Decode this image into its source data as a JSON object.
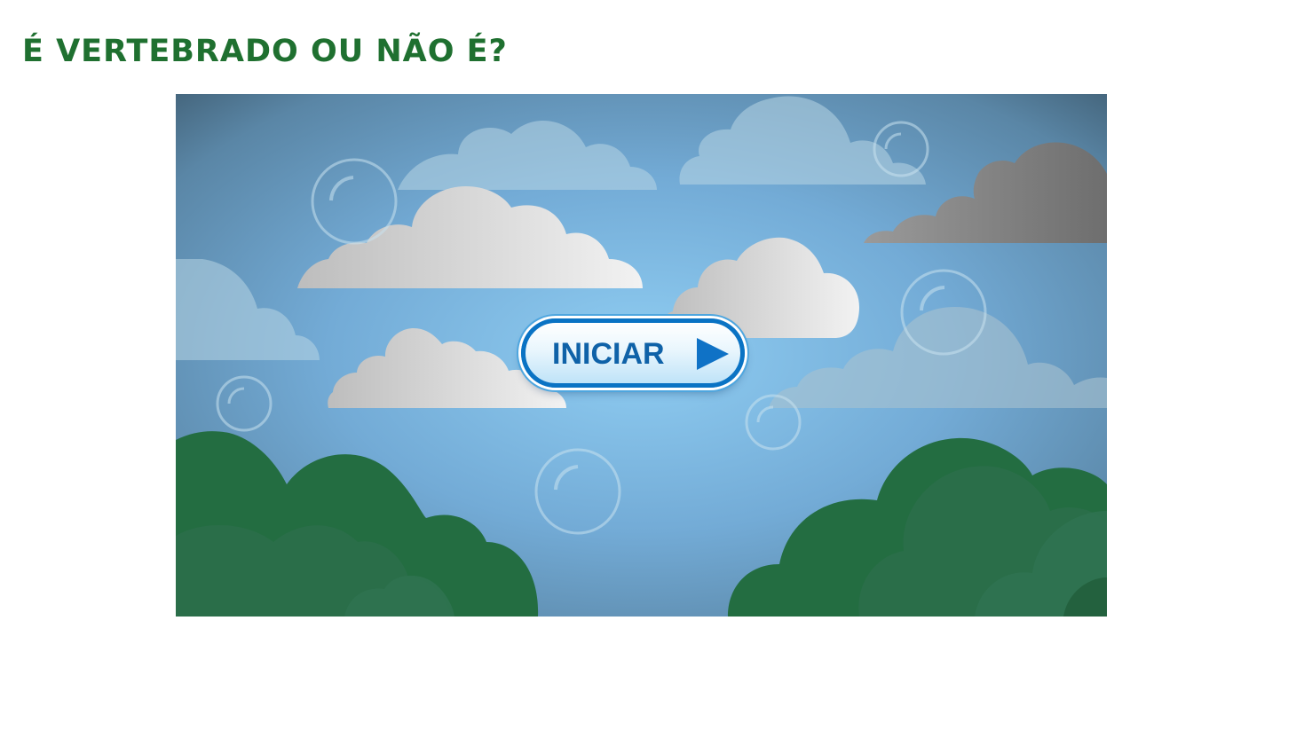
{
  "page": {
    "title": "É VERTEBRADO OU NÃO É?"
  },
  "game": {
    "start_label": "INICIAR",
    "start_icon": "play-triangle-icon"
  },
  "colors": {
    "title_green": "#1f7030",
    "sky_center": "#8fcdf2",
    "sky_edge": "#3d5a6e",
    "button_blue": "#0a73c4",
    "bush_green": "#236d41"
  }
}
